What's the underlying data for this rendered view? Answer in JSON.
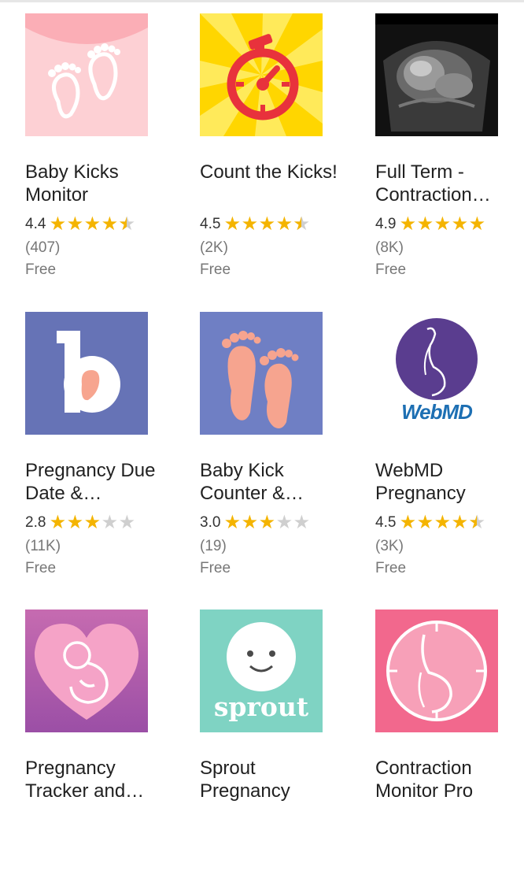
{
  "apps": [
    {
      "name": "Baby Kicks Monitor",
      "rating": "4.4",
      "rating_value": 4.4,
      "count": "(407)",
      "price": "Free",
      "icon": "baby-feet-icon"
    },
    {
      "name": "Count the Kicks!",
      "rating": "4.5",
      "rating_value": 4.5,
      "count": "(2K)",
      "price": "Free",
      "icon": "stopwatch-icon"
    },
    {
      "name": "Full Term - Contraction…",
      "rating": "4.9",
      "rating_value": 4.9,
      "count": "(8K)",
      "price": "Free",
      "icon": "ultrasound-icon"
    },
    {
      "name": "Pregnancy Due Date &…",
      "rating": "2.8",
      "rating_value": 2.8,
      "count": "(11K)",
      "price": "Free",
      "icon": "b-logo-icon"
    },
    {
      "name": "Baby Kick Counter &…",
      "rating": "3.0",
      "rating_value": 3.0,
      "count": "(19)",
      "price": "Free",
      "icon": "footprints-icon"
    },
    {
      "name": "WebMD Pregnancy",
      "rating": "4.5",
      "rating_value": 4.5,
      "count": "(3K)",
      "price": "Free",
      "icon": "webmd-pregnancy-icon",
      "logo_text": "WebMD"
    },
    {
      "name": "Pregnancy Tracker and…",
      "rating": "",
      "rating_value": null,
      "count": "",
      "price": "",
      "icon": "heart-fetus-icon"
    },
    {
      "name": "Sprout Pregnancy",
      "rating": "",
      "rating_value": null,
      "count": "",
      "price": "",
      "icon": "sprout-baby-icon",
      "logo_text": "sprout"
    },
    {
      "name": "Contraction Monitor Pro",
      "rating": "",
      "rating_value": null,
      "count": "",
      "price": "",
      "icon": "contraction-clock-icon"
    }
  ],
  "colors": {
    "star": "#f4b400",
    "star_empty": "#cfcfcf",
    "title": "#212121",
    "meta": "#777777"
  }
}
